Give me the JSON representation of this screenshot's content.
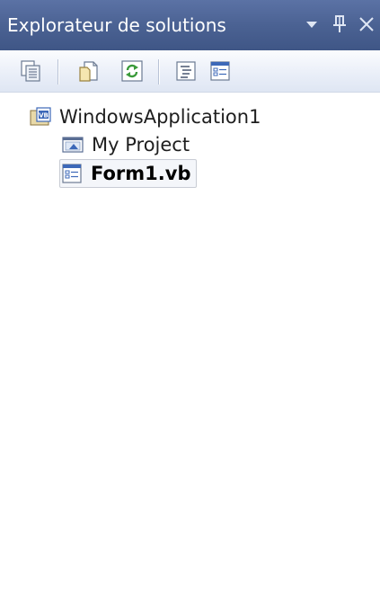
{
  "window": {
    "title": "Explorateur de solutions"
  },
  "title_buttons": {
    "dropdown_glyph": "▼",
    "pin_glyph": "⊥",
    "close_glyph": "✕"
  },
  "toolbar": {
    "buttons": [
      {
        "icon": "properties-icon"
      },
      {
        "icon": "show-all-files-icon"
      },
      {
        "icon": "refresh-icon"
      },
      {
        "icon": "view-code-icon"
      },
      {
        "icon": "view-designer-icon"
      }
    ]
  },
  "tree": {
    "project": {
      "label": "WindowsApplication1",
      "icon": "vb-project-icon"
    },
    "children": [
      {
        "label": "My Project",
        "icon": "my-project-icon"
      },
      {
        "label": "Form1.vb",
        "icon": "form-icon",
        "selected": true
      }
    ]
  },
  "colors": {
    "titlebar": "#4b6293",
    "toolbar": "#e9eef8",
    "accent_blue": "#3c68b8",
    "accent_green": "#3a9a3a"
  }
}
